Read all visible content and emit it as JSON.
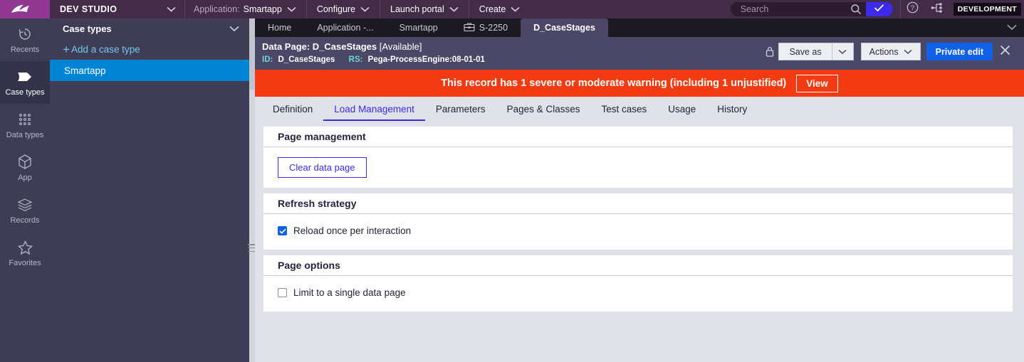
{
  "topbar": {
    "logo_icon": "pega-logo-icon",
    "studio_label": "DEV STUDIO",
    "studio_chevron_icon": "chevron-down-icon",
    "application_label": "Application:",
    "application_value": "Smartapp",
    "menus": [
      {
        "label": "Configure",
        "icon": "chevron-down-icon"
      },
      {
        "label": "Launch portal",
        "icon": "chevron-down-icon"
      },
      {
        "label": "Create",
        "icon": "chevron-down-icon"
      }
    ],
    "search": {
      "placeholder": "Search",
      "value": "",
      "icon": "search-icon",
      "submit_icon": "check-icon",
      "submit_color": "#3b2ae8"
    },
    "help_icon": "question-circle-icon",
    "nodes_icon": "share-nodes-icon",
    "environment_badge": "DEVELOPMENT",
    "bg_color": "#422c47",
    "logo_bg_color": "#8f3791"
  },
  "rail": {
    "items": [
      {
        "label": "Recents",
        "icon": "history-clock-icon",
        "active": false
      },
      {
        "label": "Case types",
        "icon": "case-type-flag-icon",
        "active": true
      },
      {
        "label": "Data types",
        "icon": "data-grid-dots-icon",
        "active": false
      },
      {
        "label": "App",
        "icon": "cube-icon",
        "active": false
      },
      {
        "label": "Records",
        "icon": "layers-stack-icon",
        "active": false
      },
      {
        "label": "Favorites",
        "icon": "star-icon",
        "active": false
      }
    ]
  },
  "sidebar": {
    "title": "Case types",
    "collapse_icon": "chevron-down-icon",
    "add_label": "Add a case type",
    "add_icon": "plus-icon",
    "items": [
      {
        "label": "Smartapp",
        "selected": true
      }
    ],
    "selected_color": "#0284d4",
    "resize_handle_icon": "resize-grip-icon"
  },
  "window_tabs": {
    "overflow_icon": "chevron-down-icon",
    "items": [
      {
        "label": "Home",
        "icon": null,
        "active": false
      },
      {
        "label": "Application -...",
        "icon": null,
        "active": false
      },
      {
        "label": "Smartapp",
        "icon": null,
        "active": false
      },
      {
        "label": "S-2250",
        "icon": "briefcase-case-icon",
        "active": false
      },
      {
        "label": "D_CaseStages",
        "icon": null,
        "active": true
      }
    ]
  },
  "record_header": {
    "title_prefix": "Data Page: D_CaseStages",
    "title_status": "[Available]",
    "id_key": "ID:",
    "id_value": "D_CaseStages",
    "rs_key": "RS:",
    "rs_value": "Pega-ProcessEngine:08-01-01",
    "lock_icon": "lock-icon",
    "save_as_label": "Save as",
    "save_as_caret_icon": "chevron-down-icon",
    "actions_label": "Actions",
    "actions_caret_icon": "chevron-down-icon",
    "private_edit_label": "Private edit",
    "close_icon": "close-icon",
    "bg_color": "#4a4866",
    "primary_color": "#1061e8"
  },
  "warning_banner": {
    "text": "This record has 1 severe or moderate warning (including 1 unjustified)",
    "button_label": "View",
    "bg_color": "#f23b12"
  },
  "sub_tabs": {
    "items": [
      {
        "label": "Definition",
        "active": false
      },
      {
        "label": "Load Management",
        "active": true
      },
      {
        "label": "Parameters",
        "active": false
      },
      {
        "label": "Pages & Classes",
        "active": false
      },
      {
        "label": "Test cases",
        "active": false
      },
      {
        "label": "Usage",
        "active": false
      },
      {
        "label": "History",
        "active": false
      }
    ],
    "active_color": "#3b2ae8"
  },
  "panels": {
    "page_management": {
      "title": "Page management",
      "clear_button_label": "Clear data page"
    },
    "refresh_strategy": {
      "title": "Refresh strategy",
      "checkbox_label": "Reload once per interaction",
      "checked": true
    },
    "page_options": {
      "title": "Page options",
      "checkbox_label": "Limit to a single data page",
      "checked": false
    }
  }
}
